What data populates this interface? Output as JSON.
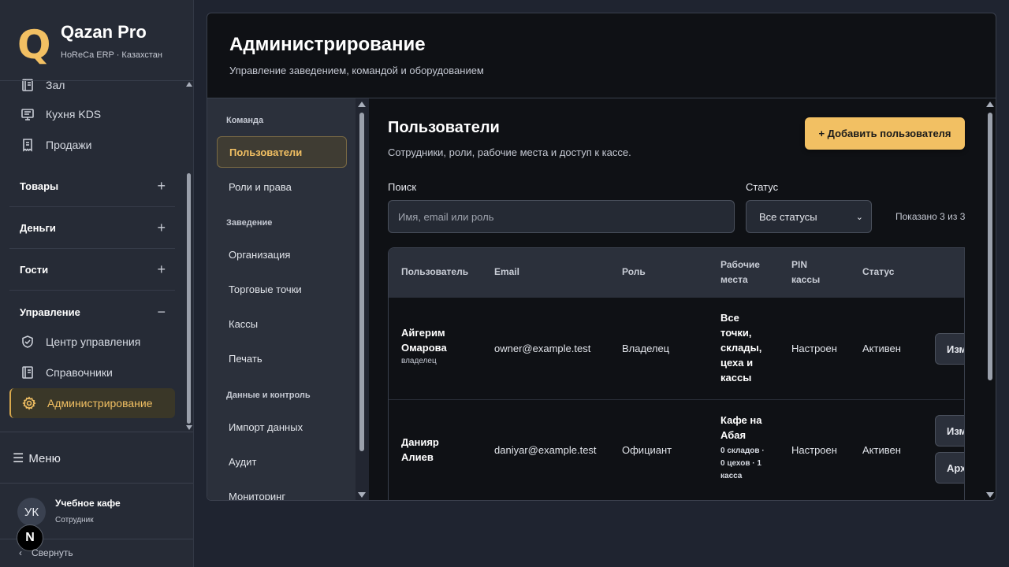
{
  "brand": {
    "logo": "Q",
    "title": "Qazan Pro",
    "subtitle": "HoReCa ERP · Казахстан"
  },
  "sidebar": {
    "items_top": [
      {
        "label": "Зал",
        "icon": "book-icon"
      },
      {
        "label": "Кухня KDS",
        "icon": "monitor-icon"
      },
      {
        "label": "Продажи",
        "icon": "receipt-icon"
      }
    ],
    "groups": [
      {
        "label": "Товары",
        "toggle": "+"
      },
      {
        "label": "Деньги",
        "toggle": "+"
      },
      {
        "label": "Гости",
        "toggle": "+"
      },
      {
        "label": "Управление",
        "toggle": "−"
      }
    ],
    "items_manage": [
      {
        "label": "Центр управления",
        "icon": "shield-icon"
      },
      {
        "label": "Справочники",
        "icon": "book-icon"
      },
      {
        "label": "Администрирование",
        "icon": "gear-icon",
        "active": true
      }
    ],
    "menu_label": "Меню",
    "user": {
      "initials": "УК",
      "name": "Учебное кафе",
      "role": "Сотрудник"
    },
    "badge": "N",
    "collapse_label": "Свернуть"
  },
  "header": {
    "title": "Администрирование",
    "subtitle": "Управление заведением, командой и оборудованием"
  },
  "subnav": {
    "sections": [
      "Команда",
      "Заведение",
      "Данные и контроль"
    ],
    "items": [
      {
        "label": "Пользователи",
        "active": true
      },
      {
        "label": "Роли и права"
      },
      {
        "label": "Организация"
      },
      {
        "label": "Торговые точки"
      },
      {
        "label": "Кассы"
      },
      {
        "label": "Печать"
      },
      {
        "label": "Импорт данных"
      },
      {
        "label": "Аудит"
      },
      {
        "label": "Мониторинг"
      }
    ]
  },
  "users": {
    "title": "Пользователи",
    "subtitle": "Сотрудники, роли, рабочие места и доступ к кассе.",
    "add_button": "+ Добавить пользователя",
    "search_label": "Поиск",
    "search_placeholder": "Имя, email или роль",
    "status_label": "Статус",
    "status_value": "Все статусы",
    "shown_count": "Показано 3 из 3",
    "columns": [
      "Пользователь",
      "Email",
      "Роль",
      "Рабочие места",
      "PIN кассы",
      "Статус"
    ],
    "rows": [
      {
        "name": "Айгерим Омарова",
        "sub": "владелец",
        "email": "owner@example.test",
        "role": "Владелец",
        "places": "Все точки, склады, цеха и кассы",
        "places_detail": "",
        "pin": "Настроен",
        "status": "Активен",
        "actions": [
          "Изм"
        ]
      },
      {
        "name": "Данияр Алиев",
        "sub": "",
        "email": "daniyar@example.test",
        "role": "Официант",
        "places": "Кафе на Абая",
        "places_detail": "0 складов · 0 цехов · 1 касса",
        "pin": "Настроен",
        "status": "Активен",
        "actions": [
          "Изм",
          "Арх"
        ]
      }
    ]
  },
  "colors": {
    "accent": "#f2c063",
    "panel": "#0f1115",
    "background": "#1f2430",
    "sidebar": "#262b36"
  }
}
